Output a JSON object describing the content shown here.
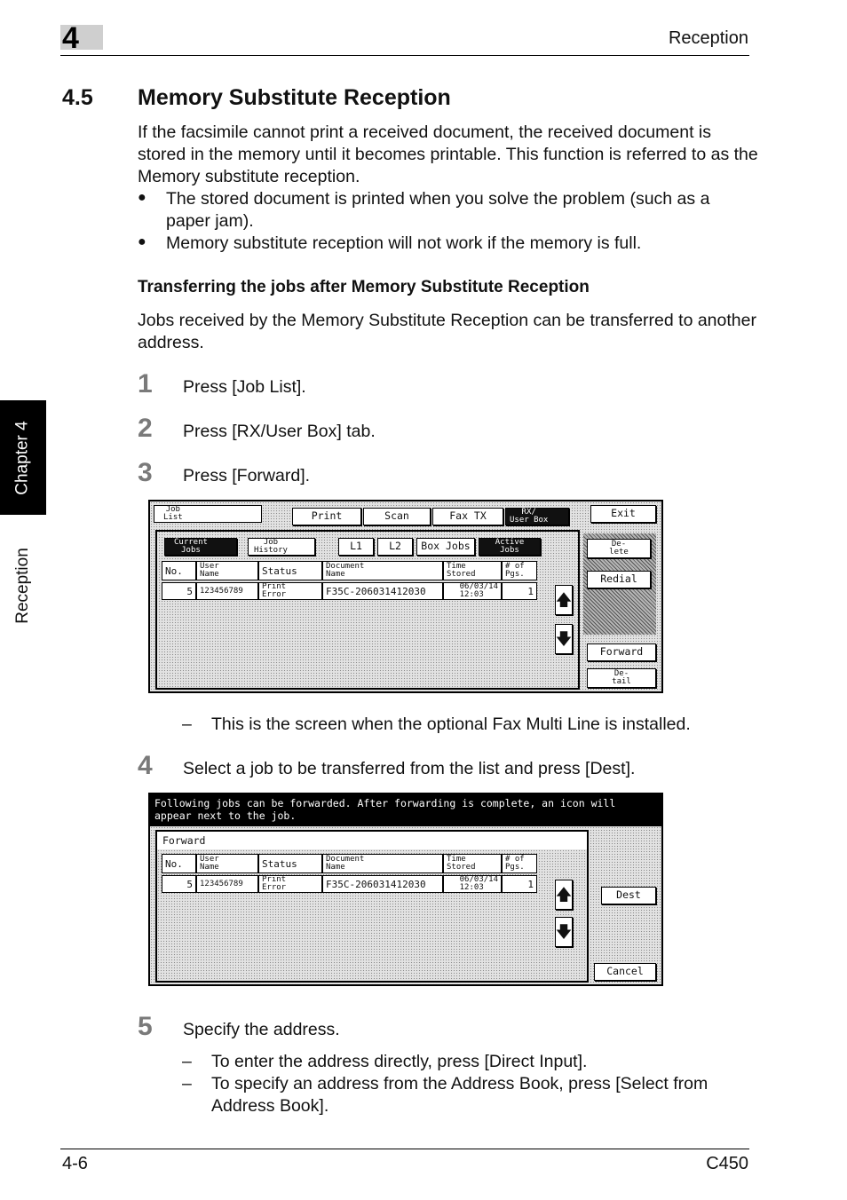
{
  "header": {
    "chapter_number": "4",
    "title": "Reception"
  },
  "side_tab": {
    "chapter": "Chapter 4",
    "section": "Reception"
  },
  "section": {
    "number": "4.5",
    "title": "Memory Substitute Reception"
  },
  "intro": "If the facsimile cannot print a received document, the received document is stored in the memory until it becomes printable. This function is referred to as the Memory substitute reception.",
  "bullets": [
    "The stored document is printed when you solve the problem (such as a paper jam).",
    "Memory substitute reception will not work if the memory is full."
  ],
  "subheading": "Transferring the jobs after Memory Substitute Reception",
  "sub_para": "Jobs received by the Memory Substitute Reception can be transferred to another address.",
  "steps": [
    {
      "num": "1",
      "text": "Press [Job List]."
    },
    {
      "num": "2",
      "text": "Press [RX/User Box] tab."
    },
    {
      "num": "3",
      "text": "Press [Forward]."
    },
    {
      "num": "4",
      "text": "Select a job to be transferred from the list and press [Dest]."
    },
    {
      "num": "5",
      "text": "Specify the address."
    }
  ],
  "step3_note": "This is the screen when the optional Fax Multi Line is installed.",
  "step5_notes": [
    "To enter the address directly, press [Direct Input].",
    "To specify an address from the Address Book, press [Select from Address Book]."
  ],
  "screen1": {
    "job_list": "Job\nList",
    "tabs": [
      "Print",
      "Scan",
      "Fax TX",
      "RX/\nUser Box"
    ],
    "exit": "Exit",
    "subtabs": [
      "Current\nJobs",
      "Job\nHistory"
    ],
    "lines": [
      "L1",
      "L2"
    ],
    "box_jobs": "Box Jobs",
    "active_jobs": "Active\nJobs",
    "columns": [
      "No.",
      "User\nName",
      "Status",
      "Document\nName",
      "Time\nStored",
      "# of\nPgs."
    ],
    "row": [
      "5",
      "123456789",
      "Print\nError",
      "F35C-206031412030",
      "06/03/14\n12:03",
      "1"
    ],
    "side_buttons": [
      "De-\nlete",
      "Redial",
      "Forward",
      "De-\ntail"
    ]
  },
  "screen2": {
    "message": "Following jobs can be forwarded. After forwarding is complete, an icon will\nappear next to the job.",
    "panel_label": "Forward",
    "columns": [
      "No.",
      "User\nName",
      "Status",
      "Document\nName",
      "Time\nStored",
      "# of\nPgs."
    ],
    "row": [
      "5",
      "123456789",
      "Print\nError",
      "F35C-206031412030",
      "06/03/14\n12:03",
      "1"
    ],
    "dest": "Dest",
    "cancel": "Cancel"
  },
  "footer": {
    "page": "4-6",
    "model": "C450"
  }
}
